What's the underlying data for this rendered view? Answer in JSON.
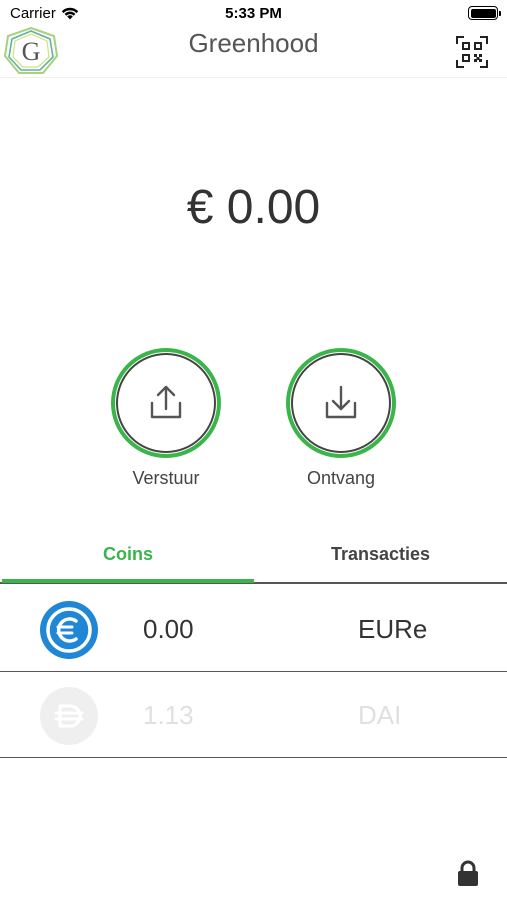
{
  "status_bar": {
    "carrier": "Carrier",
    "time": "5:33 PM",
    "icons": [
      "wifi-icon",
      "battery-icon"
    ]
  },
  "nav": {
    "logo_letter": "G",
    "title": "Greenhood",
    "right_icon": "qr-code-icon"
  },
  "balance": {
    "display": "€ 0.00"
  },
  "actions": {
    "send_label": "Verstuur",
    "receive_label": "Ontvang"
  },
  "tabs": [
    {
      "label": "Coins",
      "active": true
    },
    {
      "label": "Transacties",
      "active": false
    }
  ],
  "coins": [
    {
      "amount": "0.00",
      "symbol": "EURe",
      "icon": "euro-coin-icon",
      "enabled": true
    },
    {
      "amount": "1.13",
      "symbol": "DAI",
      "icon": "dai-coin-icon",
      "enabled": false
    }
  ],
  "footer": {
    "icon": "lock-icon"
  },
  "colors": {
    "accent": "#3ab54a",
    "euro_coin": "#1f87d6",
    "text": "#333333",
    "muted": "#e0e0e0"
  }
}
